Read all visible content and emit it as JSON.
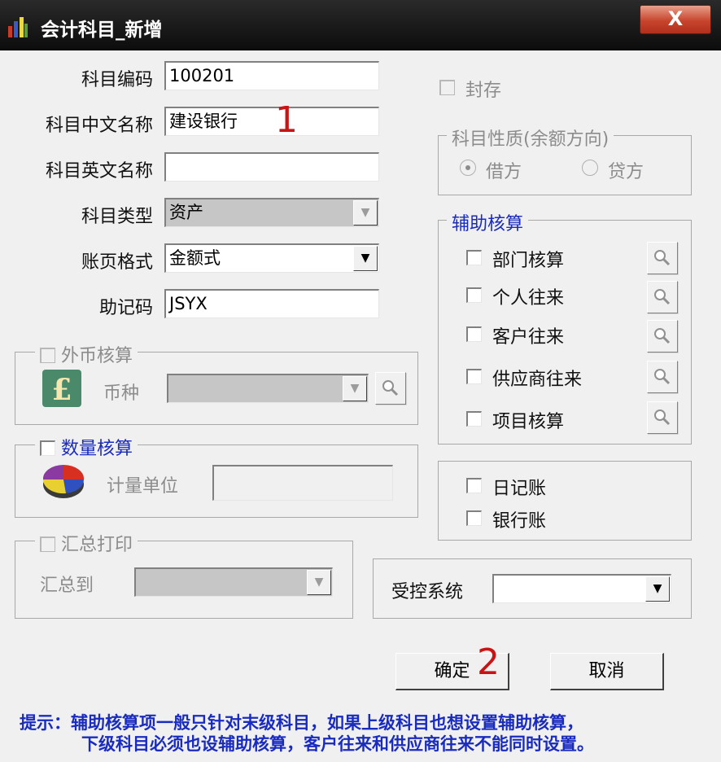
{
  "window": {
    "title": "会计科目_新增",
    "close_label": "X"
  },
  "form": {
    "code_label": "科目编码",
    "code_value": "100201",
    "cn_name_label": "科目中文名称",
    "cn_name_value": "建设银行",
    "en_name_label": "科目英文名称",
    "en_name_value": "",
    "type_label": "科目类型",
    "type_value": "资产",
    "format_label": "账页格式",
    "format_value": "金额式",
    "mnemonic_label": "助记码",
    "mnemonic_value": "JSYX"
  },
  "seal": {
    "label": "封存",
    "checked": false,
    "disabled": true
  },
  "nature": {
    "title": "科目性质(余额方向)",
    "debit": "借方",
    "credit": "贷方",
    "selected": "借方"
  },
  "auxiliary": {
    "title": "辅助核算",
    "items": [
      {
        "label": "部门核算"
      },
      {
        "label": "个人往来"
      },
      {
        "label": "客户往来"
      },
      {
        "label": "供应商往来"
      },
      {
        "label": "项目核算"
      }
    ]
  },
  "foreign": {
    "title": "外币核算",
    "currency_label": "币种",
    "currency_value": ""
  },
  "quantity": {
    "title": "数量核算",
    "unit_label": "计量单位",
    "unit_value": ""
  },
  "books": {
    "journal": "日记账",
    "bank": "银行账"
  },
  "summary": {
    "title": "汇总打印",
    "target_label": "汇总到",
    "target_value": ""
  },
  "control": {
    "label": "受控系统",
    "value": ""
  },
  "buttons": {
    "ok": "确定",
    "cancel": "取消"
  },
  "annotations": {
    "mark1": "1",
    "mark2": "2"
  },
  "hint": {
    "line1": "提示：辅助核算项一般只针对末级科目，如果上级科目也想设置辅助核算，",
    "line2": "下级科目必须也设辅助核算，客户往来和供应商往来不能同时设置。"
  },
  "colors": {
    "titlebar": "#1a1a1a",
    "hint_text": "#1a2bbf",
    "annotation": "#c81414",
    "dialog_bg": "#f0f0f0"
  },
  "icons": [
    "chart-app-icon",
    "pound-currency-icon",
    "pie-chart-icon",
    "magnifier-icon",
    "dropdown-arrow-icon"
  ]
}
